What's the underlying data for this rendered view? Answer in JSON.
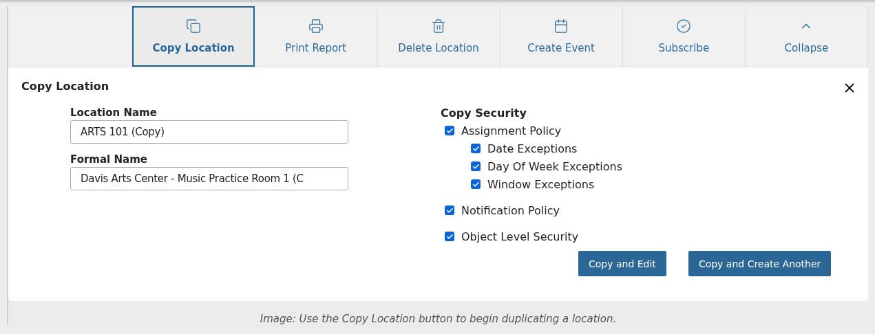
{
  "toolbar": [
    {
      "label": "Copy Location",
      "selected": true
    },
    {
      "label": "Print Report",
      "selected": false
    },
    {
      "label": "Delete Location",
      "selected": false
    },
    {
      "label": "Create Event",
      "selected": false
    },
    {
      "label": "Subscribe",
      "selected": false
    },
    {
      "label": "Collapse",
      "selected": false
    }
  ],
  "panel": {
    "title": "Copy Location",
    "fields": [
      {
        "label": "Location Name",
        "value": "ARTS 101 (Copy)"
      },
      {
        "label": "Formal Name",
        "value": "Davis Arts Center - Music Practice Room 1 (C"
      }
    ],
    "security": {
      "heading": "Copy Security",
      "options": [
        {
          "label": "Assignment Policy",
          "checked": true,
          "children": [
            {
              "label": "Date Exceptions",
              "checked": true
            },
            {
              "label": "Day Of Week Exceptions",
              "checked": true
            },
            {
              "label": "Window Exceptions",
              "checked": true
            }
          ]
        },
        {
          "label": "Notification Policy",
          "checked": true
        },
        {
          "label": "Object Level Security",
          "checked": true
        }
      ]
    },
    "buttons": [
      "Copy and Edit",
      "Copy and Create Another"
    ]
  },
  "caption": "Image: Use the Copy Location button to begin duplicating a location."
}
